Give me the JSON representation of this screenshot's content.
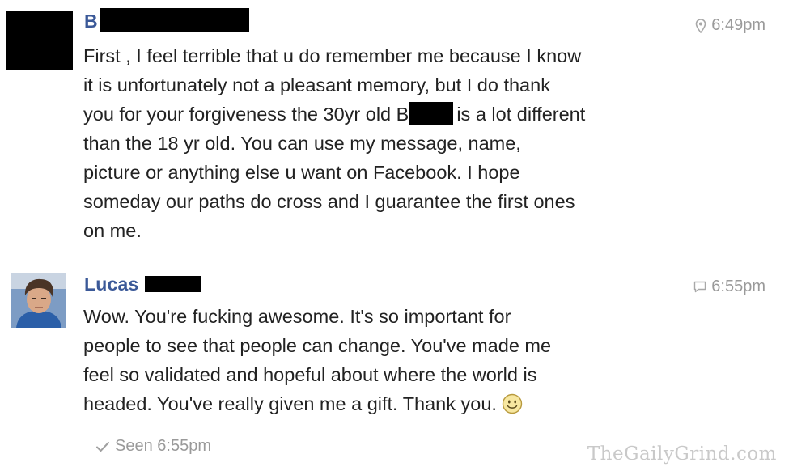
{
  "messages": [
    {
      "sender": "B",
      "time": "6:49pm",
      "time_icon": "location-pin-icon",
      "lines": [
        "First , I feel terrible that u do remember me because I know",
        "it is unfortunately not a pleasant memory, but I do thank",
        "you for your forgiveness the 30yr old B",
        "is a lot different",
        "than the 18 yr old. You can use my message, name,",
        "picture or anything else u want on Facebook. I hope",
        "someday our paths do cross and I guarantee the first ones",
        "on me."
      ]
    },
    {
      "sender": "Lucas",
      "time": "6:55pm",
      "time_icon": "chat-bubble-icon",
      "lines": [
        "Wow.  You're fucking awesome.  It's so important for",
        "people to see that people can change.  You've made me",
        "feel so validated and hopeful about where the world is",
        "headed.  You've really given me a gift.  Thank you."
      ]
    }
  ],
  "seen": {
    "icon": "checkmark-icon",
    "text": "Seen 6:55pm"
  },
  "watermark": "TheGailyGrind.com",
  "colors": {
    "name": "#3b5998",
    "meta": "#9a9a9a",
    "redaction": "#000000"
  }
}
